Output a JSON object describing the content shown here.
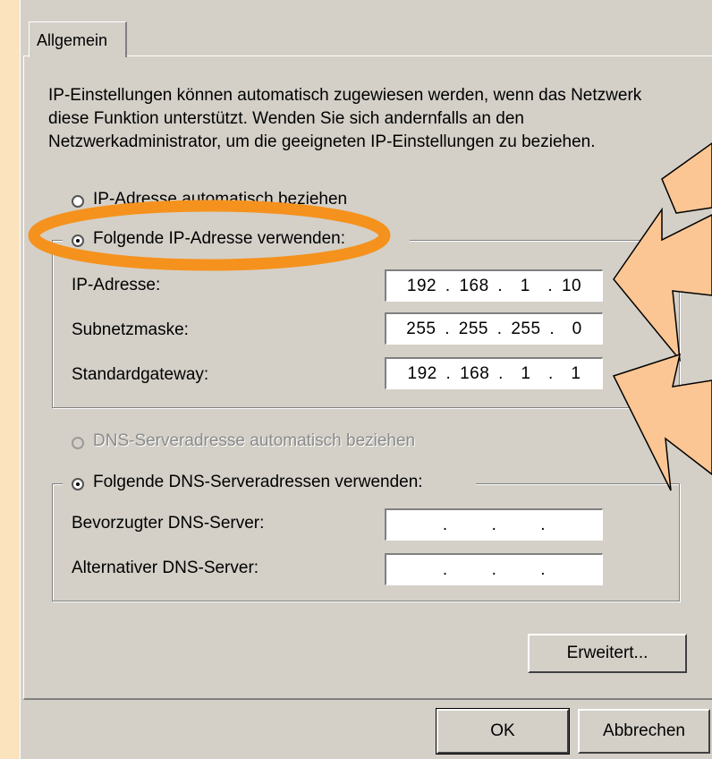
{
  "tab": {
    "label": "Allgemein"
  },
  "description": "IP-Einstellungen können automatisch zugewiesen werden, wenn das Netzwerk diese Funktion unterstützt. Wenden Sie sich andernfalls an den Netzwerkadministrator, um die geeigneten IP-Einstellungen zu beziehen.",
  "ip": {
    "auto_label": "IP-Adresse automatisch beziehen",
    "manual_label": "Folgende IP-Adresse verwenden:",
    "address_label": "IP-Adresse:",
    "address_value": "192 . 168 .  1  . 10",
    "subnet_label": "Subnetzmaske:",
    "subnet_value": "255 . 255 . 255 .  0",
    "gateway_label": "Standardgateway:",
    "gateway_value": "192 . 168 .  1  .  1"
  },
  "dns": {
    "auto_label": "DNS-Serveradresse automatisch beziehen",
    "manual_label": "Folgende DNS-Serveradressen verwenden:",
    "preferred_label": "Bevorzugter DNS-Server:",
    "preferred_value": " .     .     . ",
    "alternate_label": "Alternativer DNS-Server:",
    "alternate_value": " .     .     . "
  },
  "buttons": {
    "advanced": "Erweitert...",
    "ok": "OK",
    "cancel": "Abbrechen"
  },
  "colors": {
    "background": "#fbe3be",
    "dialog": "#d4d0c8",
    "highlight_ellipse": "#f5921e",
    "arrow_fill": "#fbc693"
  },
  "annotations": {
    "highlight": "orange-ellipse-around-manual-ip-option",
    "arrows": "arrows-pointing-to-ip-address-and-gateway"
  }
}
